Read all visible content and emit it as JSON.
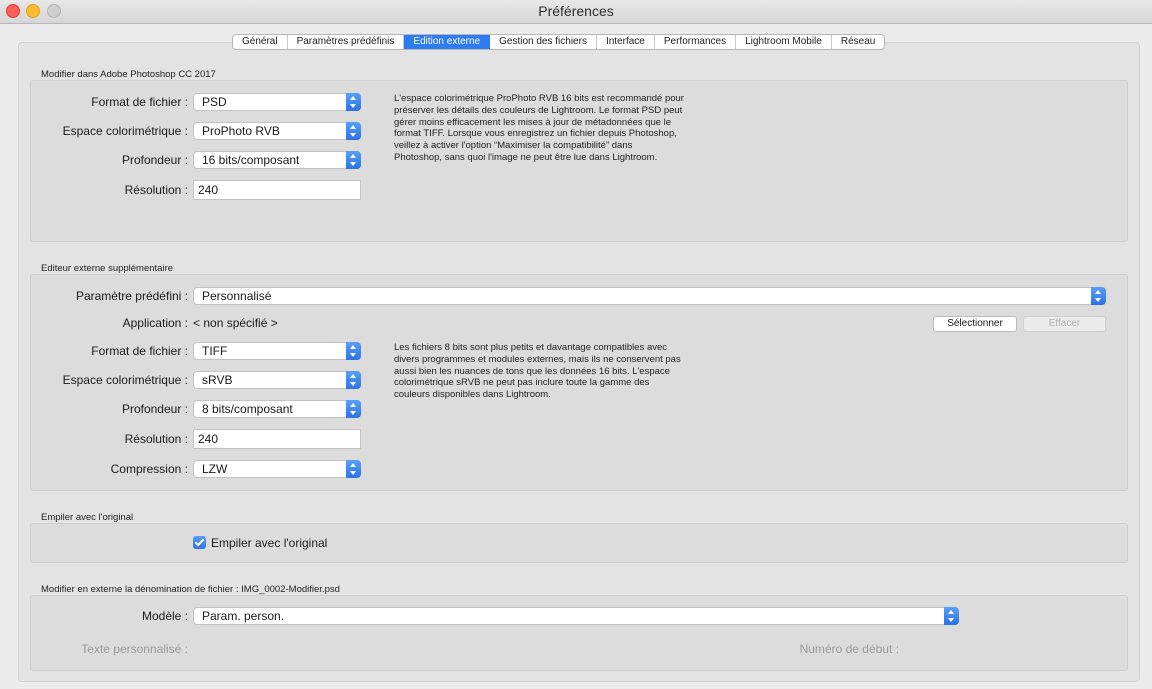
{
  "window": {
    "title": "Préférences"
  },
  "tabs": [
    {
      "label": "Général",
      "active": false
    },
    {
      "label": "Paramètres prédéfinis",
      "active": false
    },
    {
      "label": "Edition externe",
      "active": true
    },
    {
      "label": "Gestion des fichiers",
      "active": false
    },
    {
      "label": "Interface",
      "active": false
    },
    {
      "label": "Performances",
      "active": false
    },
    {
      "label": "Lightroom Mobile",
      "active": false
    },
    {
      "label": "Réseau",
      "active": false
    }
  ],
  "photoshop": {
    "section_title": "Modifier dans Adobe Photoshop CC 2017",
    "format_label": "Format de fichier :",
    "format_value": "PSD",
    "colorspace_label": "Espace colorimétrique :",
    "colorspace_value": "ProPhoto RVB",
    "depth_label": "Profondeur :",
    "depth_value": "16 bits/composant",
    "resolution_label": "Résolution :",
    "resolution_value": "240",
    "note": [
      "L'espace colorimétrique ProPhoto RVB 16 bits est recommandé pour",
      "préserver les détails des couleurs de Lightroom. Le format PSD peut",
      "gérer moins efficacement les mises à jour de métadonnées que le",
      "format TIFF. Lorsque vous enregistrez un fichier depuis Photoshop,",
      "veillez à activer l'option “Maximiser la compatibilité” dans",
      "Photoshop, sans quoi l'image ne peut être lue dans Lightroom."
    ]
  },
  "external": {
    "section_title": "Editeur externe supplémentaire",
    "preset_label": "Paramètre prédéfini :",
    "preset_value": "Personnalisé",
    "application_label": "Application :",
    "application_value": "< non spécifié >",
    "select_button": "Sélectionner",
    "clear_button": "Effacer",
    "format_label": "Format de fichier :",
    "format_value": "TIFF",
    "colorspace_label": "Espace colorimétrique :",
    "colorspace_value": "sRVB",
    "depth_label": "Profondeur :",
    "depth_value": "8 bits/composant",
    "resolution_label": "Résolution :",
    "resolution_value": "240",
    "compression_label": "Compression :",
    "compression_value": "LZW",
    "note": [
      "Les fichiers 8 bits sont plus petits et davantage compatibles avec",
      "divers programmes et modules externes, mais ils ne conservent pas",
      "aussi bien les nuances de tons que les données 16 bits. L'espace",
      "colorimétrique sRVB ne peut pas inclure toute la gamme des",
      "couleurs disponibles dans Lightroom."
    ]
  },
  "stack": {
    "section_title": "Empiler avec l'original",
    "checkbox_label": "Empiler avec l'original",
    "checked": true
  },
  "naming": {
    "section_title": "Modifier en externe la dénomination de fichier :  IMG_0002-Modifier.psd",
    "template_label": "Modèle :",
    "template_value": "Param. person.",
    "custom_text_label": "Texte personnalisé :",
    "start_number_label": "Numéro de début :"
  }
}
